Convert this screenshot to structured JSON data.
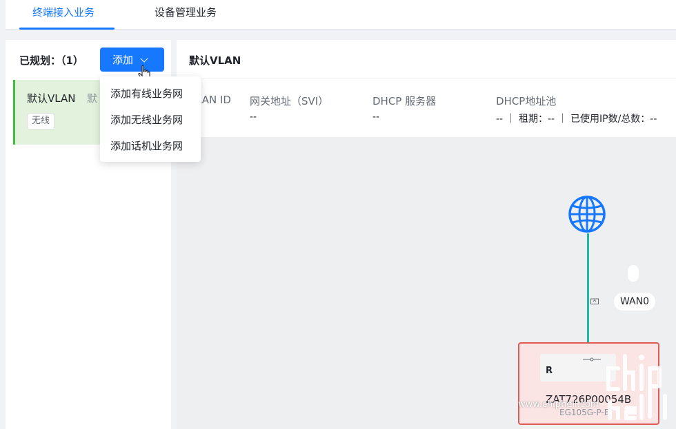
{
  "tabs": [
    {
      "label": "终端接入业务",
      "active": true
    },
    {
      "label": "设备管理业务",
      "active": false
    }
  ],
  "left": {
    "planned_label": "已规划：（1）",
    "add_button": "添加",
    "vlan_card": {
      "title": "默认VLAN",
      "title_extra": "默",
      "tag": "无线"
    }
  },
  "dropdown": {
    "items": [
      "添加有线业务网",
      "添加无线业务网",
      "添加话机业务网"
    ]
  },
  "right": {
    "title": "默认VLAN",
    "columns": [
      {
        "header": "LAN ID",
        "value": ""
      },
      {
        "header": "网关地址（SVI）",
        "value": "--"
      },
      {
        "header": "DHCP 服务器",
        "value": "--"
      },
      {
        "header": "DHCP地址池",
        "value": "-- ｜ 租期：-- ｜ 已使用IP数/总数：--"
      }
    ]
  },
  "topology": {
    "wan_label": "WAN0",
    "device": {
      "badge": "R",
      "name": "ZAT726P00054B",
      "model": "EG105G-P-E"
    }
  },
  "watermark": {
    "url": "www.chiphell.com",
    "logo_text": "chip hell"
  },
  "colors": {
    "accent": "#1677ff",
    "link": "#1fb8a4",
    "device_border": "#e05a55",
    "card_green": "#3fbf3a"
  }
}
